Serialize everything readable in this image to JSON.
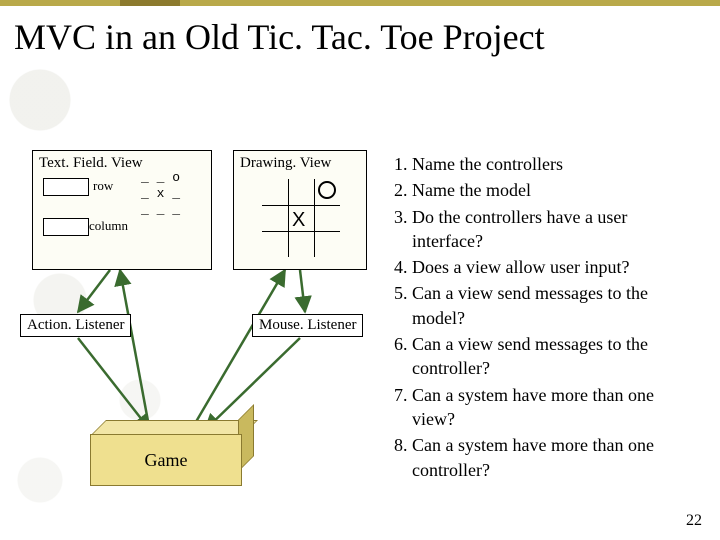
{
  "title": "MVC in an Old Tic. Tac. Toe Project",
  "text_field_view": {
    "label": "Text. Field. View",
    "row_label": "row",
    "column_label": "column",
    "board_text": "_ _ o\n_ x _\n_ _ _"
  },
  "drawing_view": {
    "label": "Drawing. View",
    "x_mark": "X"
  },
  "action_listener": "Action. Listener",
  "mouse_listener": "Mouse. Listener",
  "game_label": "Game",
  "questions": [
    "Name the controllers",
    "Name the model",
    "Do the controllers have a user interface?",
    "Does a view allow user input?",
    "Can a view send messages to the model?",
    "Can a view send messages to the controller?",
    "Can a system have more than one view?",
    "Can a system have more than one controller?"
  ],
  "slide_number": "22"
}
